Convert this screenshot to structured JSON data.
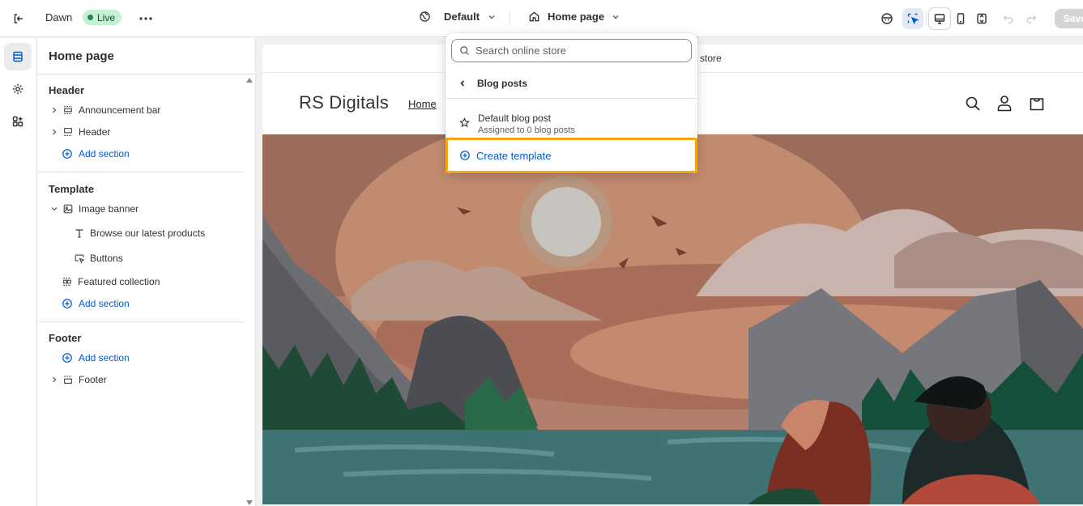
{
  "topbar": {
    "theme_name": "Dawn",
    "live_badge": "Live",
    "theme_selector": "Default",
    "page_selector": "Home page",
    "save_label": "Save"
  },
  "sidebar": {
    "title": "Home page",
    "groups": [
      {
        "heading": "Header",
        "items": [
          "Announcement bar",
          "Header"
        ],
        "add_label": "Add section"
      },
      {
        "heading": "Template",
        "items": [
          "Image banner",
          "Browse our latest products",
          "Buttons",
          "Featured collection"
        ],
        "add_label": "Add section"
      },
      {
        "heading": "Footer",
        "items": [
          "Footer"
        ],
        "add_label": "Add section"
      }
    ]
  },
  "dropdown": {
    "search_placeholder": "Search online store",
    "back_label": "Blog posts",
    "template_name": "Default blog post",
    "template_meta": "Assigned to 0 blog posts",
    "create_label": "Create template"
  },
  "preview": {
    "announcement_text": "store",
    "brand": "RS Digitals",
    "nav_home": "Home"
  },
  "colors": {
    "accent": "#005bd3",
    "highlight": "#f6a612",
    "live_bg": "#c5f0d2"
  }
}
